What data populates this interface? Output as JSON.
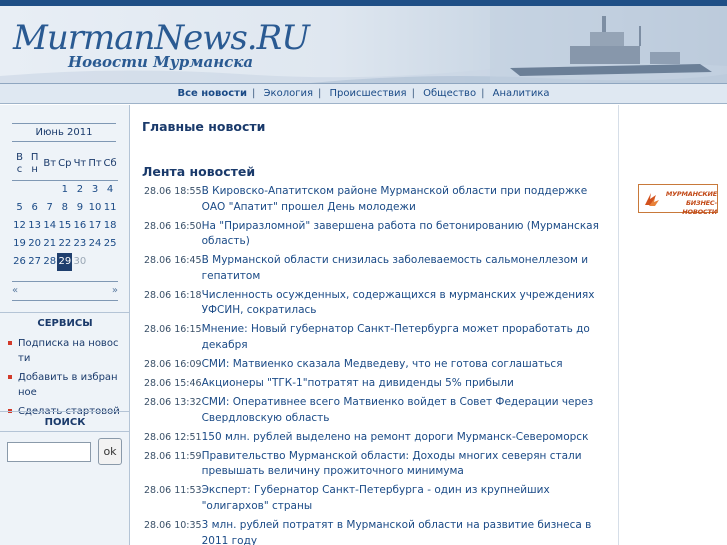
{
  "header": {
    "logo_title": "MurmanNews.RU",
    "logo_subtitle": "Новости Мурманска"
  },
  "nav": {
    "items": [
      {
        "label": "Все новости",
        "active": true
      },
      {
        "label": "Экология"
      },
      {
        "label": "Происшествия"
      },
      {
        "label": "Общество"
      },
      {
        "label": "Аналитика"
      }
    ],
    "separator": "|"
  },
  "calendar": {
    "month_title": "Июнь 2011",
    "weekdays": [
      "В\nс",
      "П\nн",
      "Вт",
      "Ср",
      "Чт",
      "Пт",
      "Сб"
    ],
    "weeks": [
      [
        "",
        "",
        "",
        "1",
        "2",
        "3",
        "4"
      ],
      [
        "5",
        "6",
        "7",
        "8",
        "9",
        "10",
        "11"
      ],
      [
        "12",
        "13",
        "14",
        "15",
        "16",
        "17",
        "18"
      ],
      [
        "19",
        "20",
        "21",
        "22",
        "23",
        "24",
        "25"
      ],
      [
        "26",
        "27",
        "28",
        "29",
        "30",
        "",
        ""
      ]
    ],
    "today": "29",
    "future_days": [
      "30"
    ],
    "prev": "«",
    "next": "»"
  },
  "services": {
    "title": "СЕРВИСЫ",
    "items": [
      "Подписка на новости",
      "Добавить в избранное",
      "Сделать стартовой"
    ]
  },
  "search": {
    "title": "ПОИСК",
    "value": "",
    "button": "ok"
  },
  "main": {
    "top_news_title": "Главные новости",
    "feed_title": "Лента новостей",
    "feed": [
      {
        "time": "28.06 18:55",
        "title": "В Кировско-Апатитском районе Мурманской области при поддержке ОАО \"Апатит\" прошел День молодежи"
      },
      {
        "time": "28.06 16:50",
        "title": "На \"Приразломной\" завершена работа по бетонированию (Мурманская область)"
      },
      {
        "time": "28.06 16:45",
        "title": "В Мурманской области снизилась заболеваемость сальмонеллезом и гепатитом"
      },
      {
        "time": "28.06 16:18",
        "title": "Численность осужденных, содержащихся в мурманских учреждениях УФСИН, сократилась"
      },
      {
        "time": "28.06 16:15",
        "title": "Мнение: Новый губернатор Санкт-Петербурга может проработать до декабря"
      },
      {
        "time": "28.06 16:09",
        "title": "СМИ: Матвиенко сказала Медведеву, что не готова соглашаться"
      },
      {
        "time": "28.06 15:46",
        "title": "Акционеры \"ТГК-1\"потратят на дивиденды 5% прибыли"
      },
      {
        "time": "28.06 13:32",
        "title": "СМИ: Оперативнее всего Матвиенко войдет в Совет Федерации через Свердловскую область"
      },
      {
        "time": "28.06 12:51",
        "title": "150 млн. рублей выделено на ремонт дороги Мурманск-Североморск"
      },
      {
        "time": "28.06 11:59",
        "title": "Правительство Мурманской области: Доходы многих северян стали превышать величину прожиточного минимума"
      },
      {
        "time": "28.06 11:53",
        "title": "Эксперт: Губернатор Санкт-Петербурга - один из крупнейших \"олигархов\" страны"
      },
      {
        "time": "28.06 10:35",
        "title": "3 млн. рублей потратят в Мурманской области на развитие бизнеса в 2011 году"
      }
    ]
  },
  "banner": {
    "text_line1": "МУРМАНСКИЕ",
    "text_line2": "БИЗНЕС-НОВОСТИ",
    "icon": "flame-icon"
  },
  "colors": {
    "brand_blue": "#1f4f86",
    "link_blue": "#1a4a86",
    "today_bg": "#1f3f6e",
    "bullet_red": "#d23a2a",
    "banner_orange": "#c24a18"
  }
}
